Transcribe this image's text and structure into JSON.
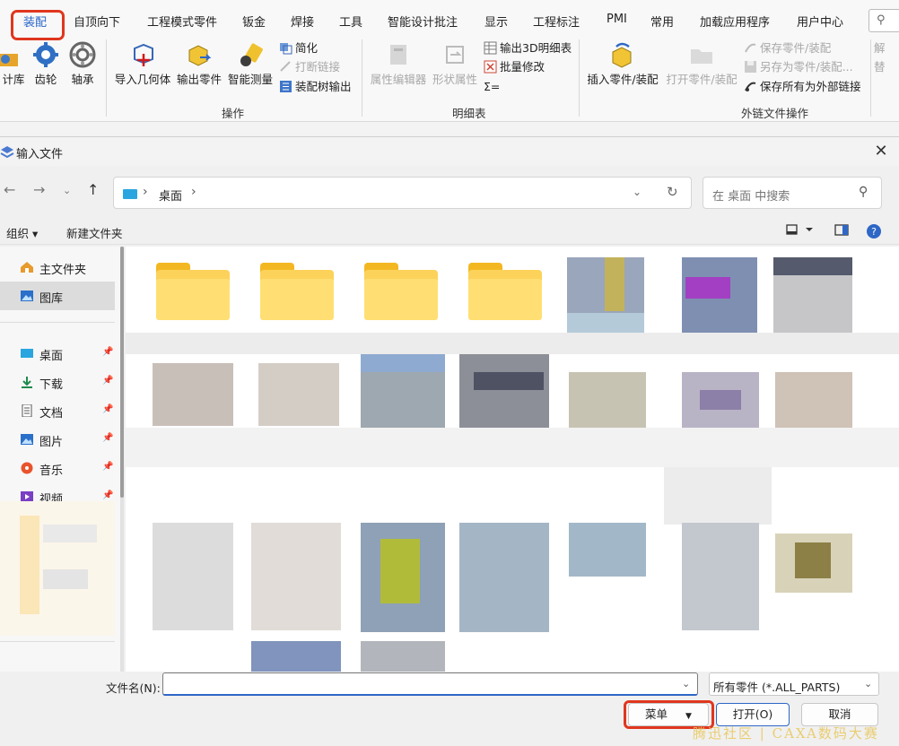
{
  "ribbon": {
    "tabs": [
      "装配",
      "自顶向下",
      "工程模式零件",
      "钣金",
      "焊接",
      "工具",
      "智能设计批注",
      "显示",
      "工程标注",
      "PMI",
      "常用",
      "加载应用程序",
      "用户中心"
    ],
    "active_tab": "装配",
    "buttons_left": [
      "计库",
      "齿轮",
      "轴承"
    ],
    "operate_buttons": [
      "导入几何体",
      "输出零件",
      "智能测量"
    ],
    "operate_small": [
      "简化",
      "打断链接",
      "装配树输出"
    ],
    "operate_group": "操作",
    "detail_buttons": [
      "属性编辑器",
      "形状属性"
    ],
    "detail_small": [
      "输出3D明细表",
      "批量修改",
      "Σ="
    ],
    "detail_group": "明细表",
    "ext_buttons": [
      "插入零件/装配",
      "打开零件/装配"
    ],
    "ext_small": [
      "保存零件/装配",
      "另存为零件/装配...",
      "保存所有为外部链接"
    ],
    "ext_group": "外链文件操作",
    "cut_small": [
      "解",
      "替"
    ]
  },
  "dialog": {
    "title": "输入文件",
    "close": "✕",
    "address": {
      "crumb": "桌面"
    },
    "search_placeholder": "在 桌面 中搜索",
    "toolbar": {
      "organize": "组织 ▾",
      "new_folder": "新建文件夹"
    },
    "nav": [
      {
        "label": "主文件夹",
        "icon": "home-icon",
        "pinned": false
      },
      {
        "label": "图库",
        "icon": "gallery-icon",
        "pinned": false
      },
      {
        "label": "桌面",
        "icon": "desktop-icon",
        "pinned": true
      },
      {
        "label": "下载",
        "icon": "download-icon",
        "pinned": true
      },
      {
        "label": "文档",
        "icon": "document-icon",
        "pinned": true
      },
      {
        "label": "图片",
        "icon": "picture-icon",
        "pinned": true
      },
      {
        "label": "音乐",
        "icon": "music-icon",
        "pinned": true
      },
      {
        "label": "视频",
        "icon": "video-icon",
        "pinned": true
      }
    ],
    "filename_label": "文件名(N):",
    "filename_value": "",
    "filetype": "所有零件 (*.ALL_PARTS)",
    "buttons": {
      "menu": "菜单",
      "open": "打开(O)",
      "cancel": "取消"
    },
    "watermark": "腾迅社区 | CAXA数码大赛"
  }
}
